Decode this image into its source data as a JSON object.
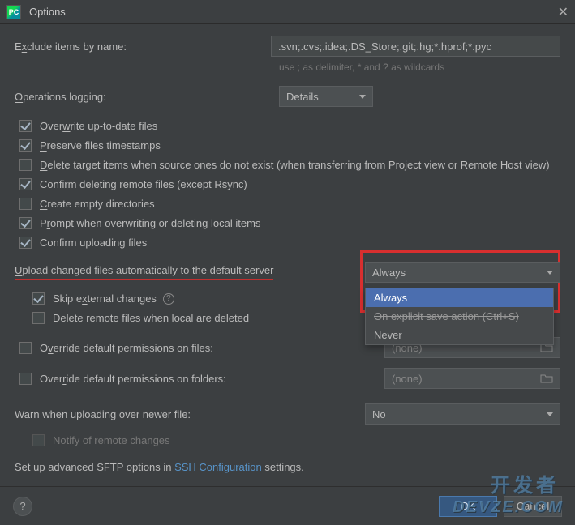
{
  "window": {
    "title": "Options",
    "app_abbr": "PC"
  },
  "exclude": {
    "label_pre": "E",
    "label_mid": "x",
    "label_post": "clude items by name:",
    "value": ".svn;.cvs;.idea;.DS_Store;.git;.hg;*.hprof;*.pyc",
    "helper": "use ; as delimiter, * and ? as wildcards"
  },
  "ops_logging": {
    "label_pre": "",
    "label_mid": "O",
    "label_post": "perations logging:",
    "value": "Details"
  },
  "checks": {
    "overwrite": {
      "pre": "Over",
      "u": "w",
      "post": "rite up-to-date files"
    },
    "preserve": {
      "pre": "",
      "u": "P",
      "post": "reserve files timestamps"
    },
    "delete_target": {
      "pre": "",
      "u": "D",
      "post": "elete target items when source ones do not exist (when transferring from Project view or Remote Host view)"
    },
    "confirm_del": "Confirm deleting remote files (except Rsync)",
    "create_empty": {
      "pre": "",
      "u": "C",
      "post": "reate empty directories"
    },
    "prompt_overwrite": {
      "pre": "P",
      "u": "r",
      "post": "ompt when overwriting or deleting local items"
    },
    "confirm_upload": "Confirm uploading files"
  },
  "upload_auto": {
    "label_pre": "",
    "label_mid": "U",
    "label_post": "pload changed files automatically to the default server",
    "value": "Always",
    "options": {
      "always": "Always",
      "explicit": "On explicit save action (Ctrl+S)",
      "never": "Never"
    }
  },
  "skip_ext": {
    "pre": "Skip e",
    "u": "x",
    "post": "ternal changes"
  },
  "delete_remote": "Delete remote files when local are deleted",
  "override_files": {
    "pre": "O",
    "u": "v",
    "post": "erride default permissions on files:",
    "value": "(none)"
  },
  "override_folders": {
    "pre": "Over",
    "u": "r",
    "post": "ide default permissions on folders:",
    "value": "(none)"
  },
  "warn_newer": {
    "pre": "Warn when uploading over ",
    "u": "n",
    "post": "ewer file:",
    "value": "No"
  },
  "notify_remote": {
    "pre": "Notify of remote c",
    "u": "h",
    "post": "anges"
  },
  "sftp_text": {
    "pre": "Set up advanced SFTP options in ",
    "link": "SSH Configuration",
    "post": " settings."
  },
  "buttons": {
    "help": "?",
    "ok": "OK",
    "cancel": "Cancel"
  },
  "watermark": {
    "line1": "开发者",
    "line2": "DEVZE.COM"
  }
}
